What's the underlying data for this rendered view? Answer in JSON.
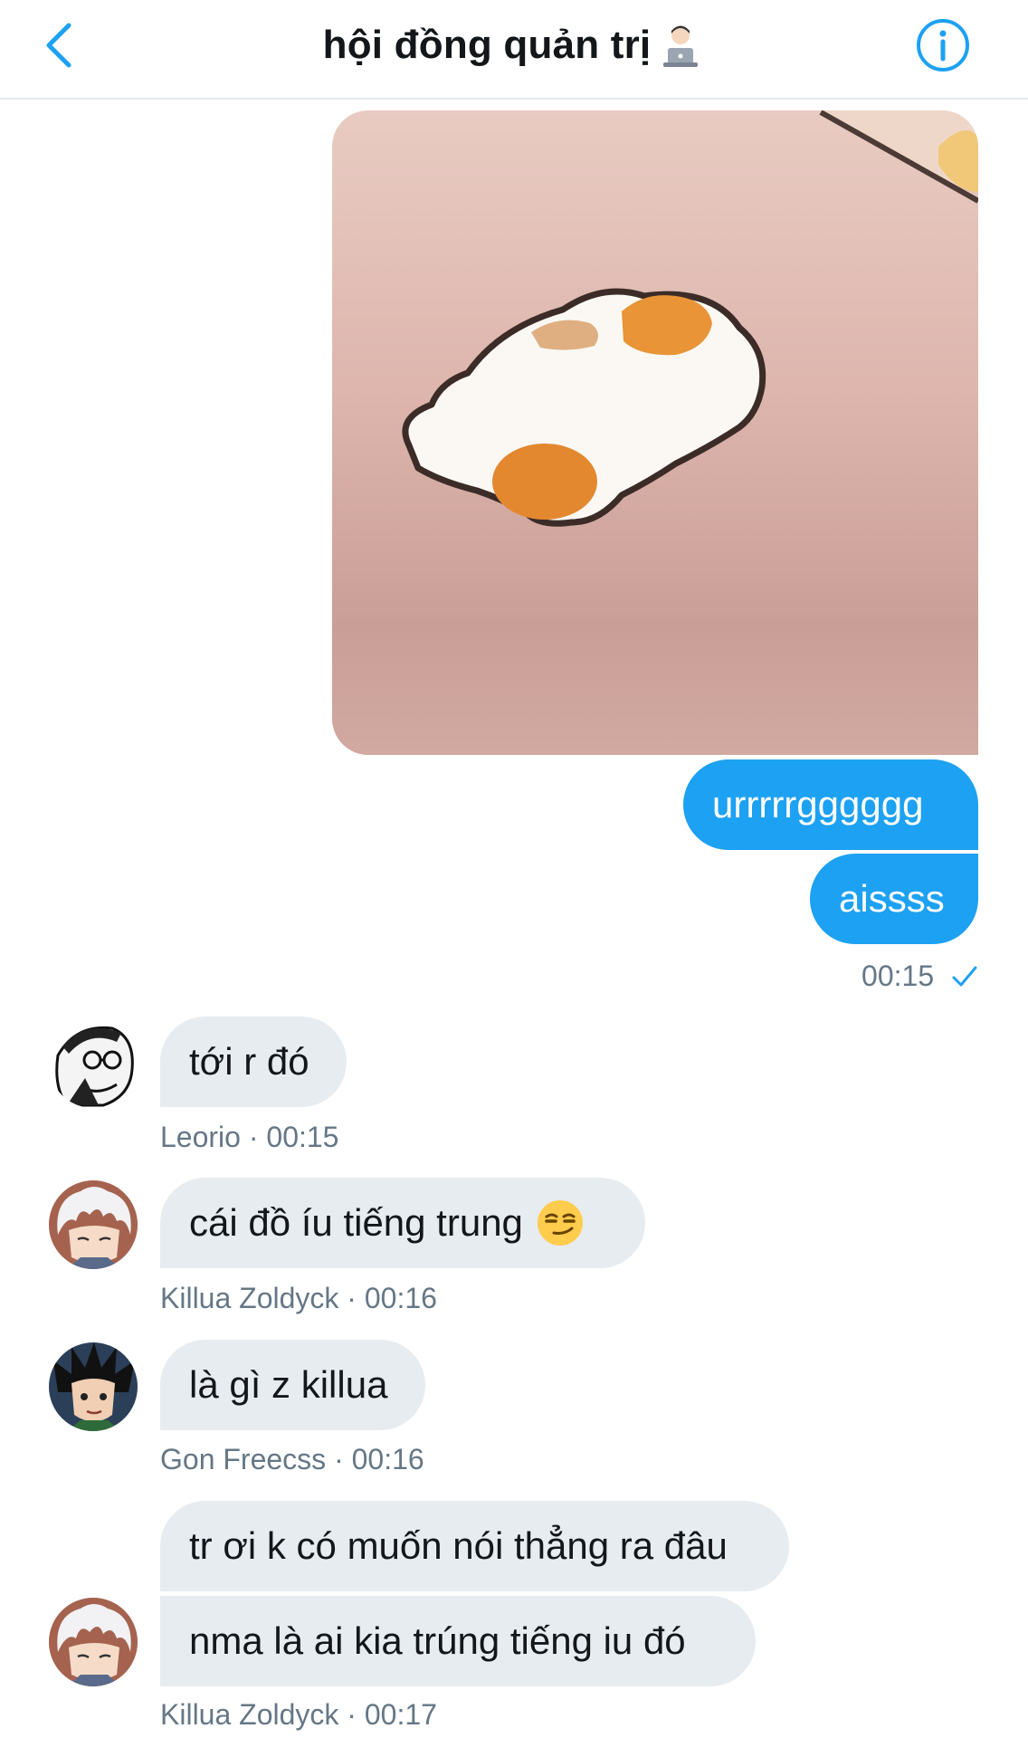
{
  "header": {
    "title": "hội đồng quản trị",
    "title_emoji": "technologist-emoji",
    "back_icon": "chevron-left-icon",
    "info_icon": "info-icon"
  },
  "colors": {
    "accent": "#1da1f2",
    "incoming_bubble": "#e6ecf0",
    "meta_text": "#657786"
  },
  "outgoing": {
    "media": "hamster-cartoon-image",
    "messages": [
      "urrrrrgggggg",
      "aissss"
    ],
    "time": "00:15",
    "status_icon": "checkmark-icon"
  },
  "incoming": [
    {
      "sender": "Leorio",
      "time": "00:15",
      "separator": "·",
      "messages": [
        "tới r đó"
      ],
      "avatar": "leorio-avatar"
    },
    {
      "sender": "Killua Zoldyck",
      "time": "00:16",
      "separator": "·",
      "messages": [
        "cái đồ íu tiếng trung"
      ],
      "emoji": "smirking-face-emoji",
      "avatar": "killua-avatar"
    },
    {
      "sender": "Gon Freecss",
      "time": "00:16",
      "separator": "·",
      "messages": [
        "là gì z killua"
      ],
      "avatar": "gon-avatar"
    },
    {
      "sender": "Killua Zoldyck",
      "time": "00:17",
      "separator": "·",
      "messages": [
        "tr ơi k có muốn nói thẳng ra đâu",
        "nma là ai kia trúng tiếng iu đó"
      ],
      "avatar": "killua-avatar"
    }
  ]
}
